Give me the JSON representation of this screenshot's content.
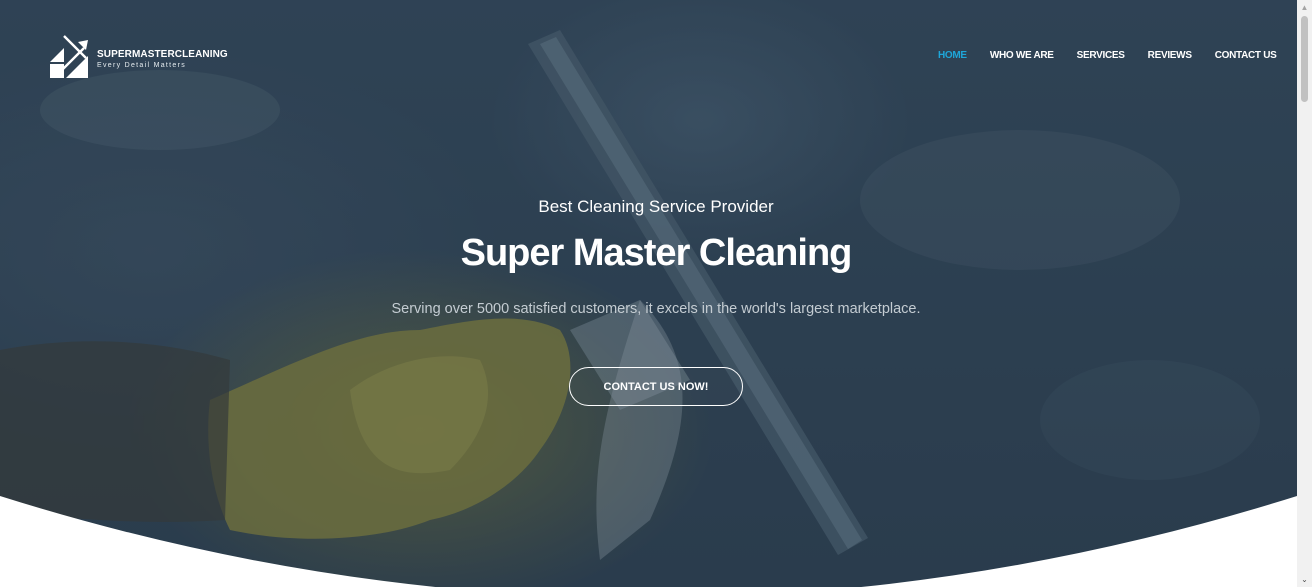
{
  "brand": {
    "name": "SUPERMASTERCLEANING",
    "tagline": "Every Detail Matters"
  },
  "nav": {
    "items": [
      {
        "label": "HOME",
        "active": true
      },
      {
        "label": "WHO WE ARE",
        "active": false
      },
      {
        "label": "SERVICES",
        "active": false
      },
      {
        "label": "REVIEWS",
        "active": false
      },
      {
        "label": "CONTACT US",
        "active": false
      }
    ]
  },
  "hero": {
    "kicker": "Best Cleaning Service Provider",
    "title": "Super Master Cleaning",
    "subtitle": "Serving over 5000 satisfied customers, it excels in the world's largest marketplace.",
    "cta_label": "CONTACT US NOW!"
  },
  "colors": {
    "accent": "#1ea6d9",
    "overlay": "#2c3e50",
    "text": "#ffffff"
  },
  "icons": {
    "logo": "diamond-arrow-logo-icon",
    "scroll_up": "chevron-up-icon",
    "scroll_down": "chevron-down-icon"
  }
}
